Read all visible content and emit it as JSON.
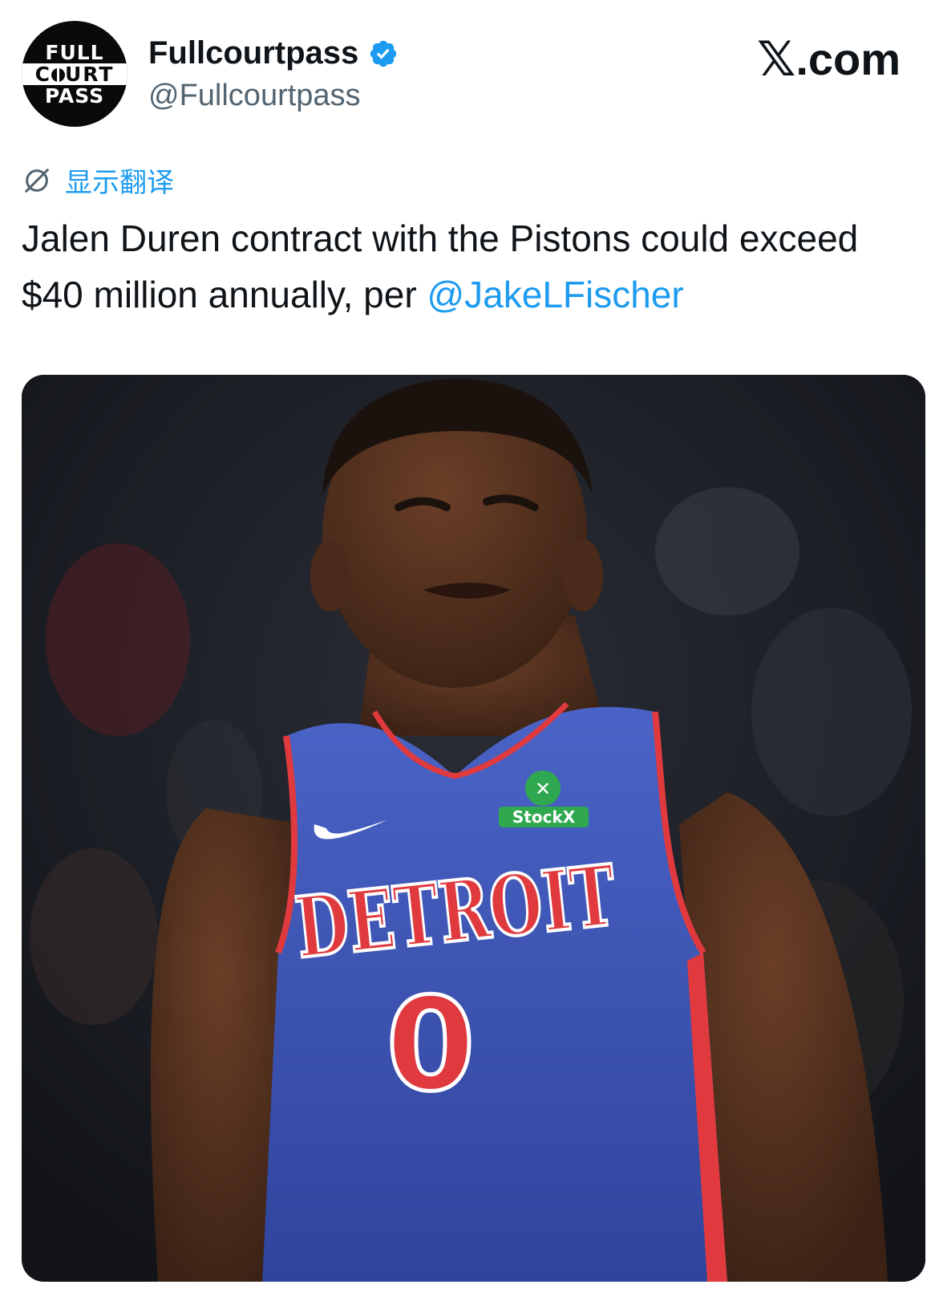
{
  "account": {
    "avatar_lines": [
      "FULL",
      "C",
      "URT",
      "PASS"
    ],
    "display_name": "Fullcourtpass",
    "handle": "@Fullcourtpass",
    "verified": true,
    "verified_color": "#1d9bf0"
  },
  "brand": {
    "x_mark": "𝕏",
    "domain": ".com"
  },
  "translate": {
    "icon": "translate-globe-icon",
    "label": "显示翻译"
  },
  "tweet": {
    "text": "Jalen Duren contract with the Pistons could exceed $40 million annually, per ",
    "mention": "@JakeLFischer"
  },
  "media": {
    "jersey": {
      "team": "DETROIT",
      "number": "0",
      "sponsor": "StockX",
      "jersey_color": "#3f57b8",
      "trim_color": "#e03a3e"
    }
  },
  "colors": {
    "link": "#1d9bf0",
    "text": "#0f1419",
    "secondary": "#536471"
  }
}
